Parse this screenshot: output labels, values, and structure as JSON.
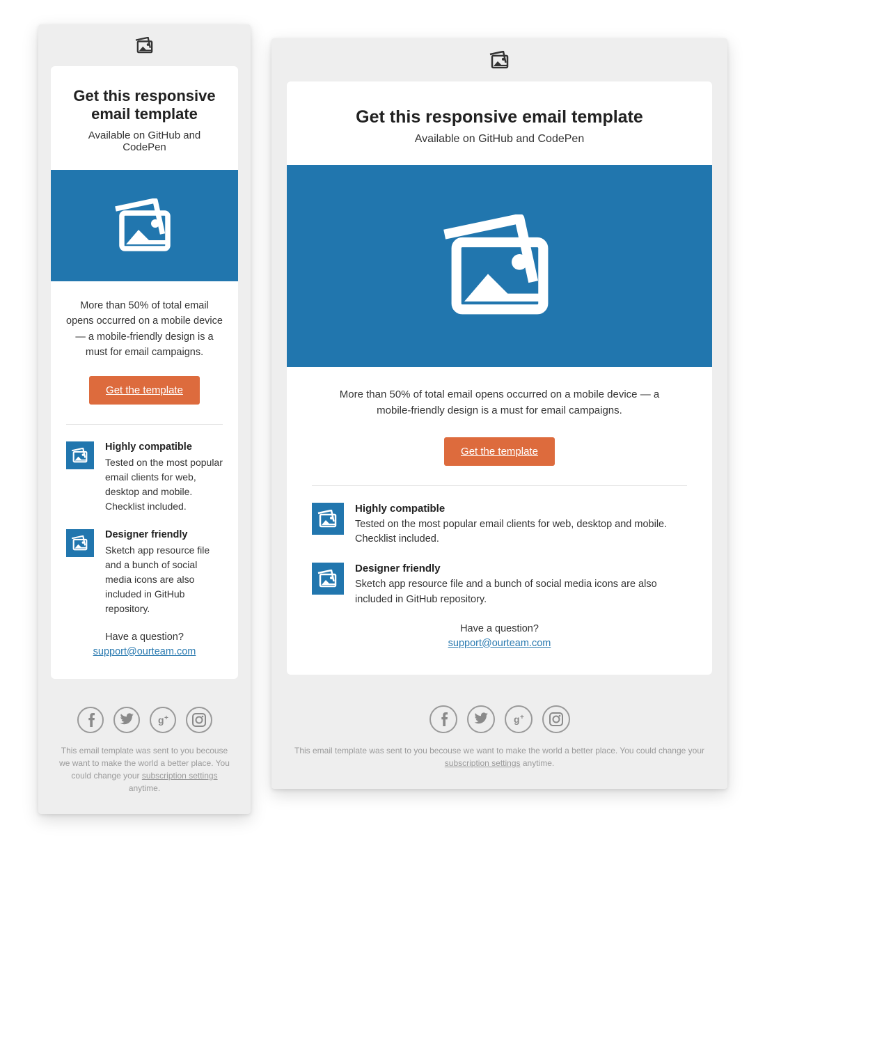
{
  "email": {
    "heading": "Get this responsive email template",
    "subheading": "Available on GitHub and CodePen",
    "body": "More than 50% of total email opens occurred on a mobile device — a mobile-friendly design is a must for email campaigns.",
    "cta_label": "Get the template",
    "features": [
      {
        "title": "Highly compatible",
        "desc": "Tested on the most popular email clients for web, desktop and mobile. Checklist included."
      },
      {
        "title": "Designer friendly",
        "desc": "Sketch app resource file and a bunch of social media icons are also included in GitHub repository."
      }
    ],
    "question": "Have a question?",
    "support_email": "support@ourteam.com"
  },
  "footer": {
    "social": [
      "facebook",
      "twitter",
      "googleplus",
      "instagram"
    ],
    "legal_pre": "This email template was sent to you becouse we want to make the world a better place. You could change your ",
    "legal_link": "subscription settings",
    "legal_post": " anytime."
  },
  "colors": {
    "accent": "#2176ae",
    "cta": "#dd6b3d"
  }
}
